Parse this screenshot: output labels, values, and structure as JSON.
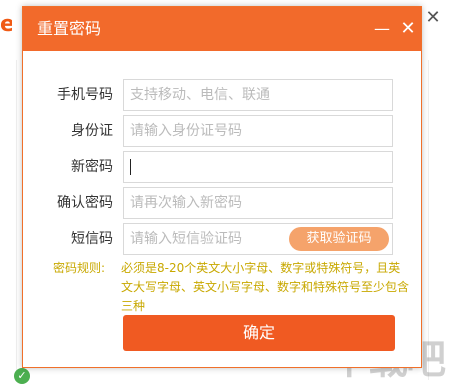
{
  "dialog": {
    "title": "重置密码",
    "minimize_glyph": "—",
    "close_glyph": "✕"
  },
  "form": {
    "phone": {
      "label": "手机号码",
      "placeholder": "支持移动、电信、联通"
    },
    "id_card": {
      "label": "身份证",
      "placeholder": "请输入身份证号码"
    },
    "new_password": {
      "label": "新密码",
      "value": ""
    },
    "confirm_password": {
      "label": "确认密码",
      "placeholder": "请再次输入新密码"
    },
    "sms_code": {
      "label": "短信码",
      "placeholder": "请输入短信验证码",
      "get_code_label": "获取验证码"
    }
  },
  "hint": {
    "title": "密码规则:",
    "text": "必须是8-20个英文大小字母、数字或特殊符号，且英文大写字母、英文小写字母、数字和特殊符号至少包含三种"
  },
  "confirm_button": "确定",
  "colors": {
    "accent": "#f26a2b",
    "button": "#f05a22",
    "code_button": "#f5a36b",
    "hint": "#c8a800"
  },
  "icons": {
    "minimize": "minimize-icon",
    "close": "close-icon"
  }
}
